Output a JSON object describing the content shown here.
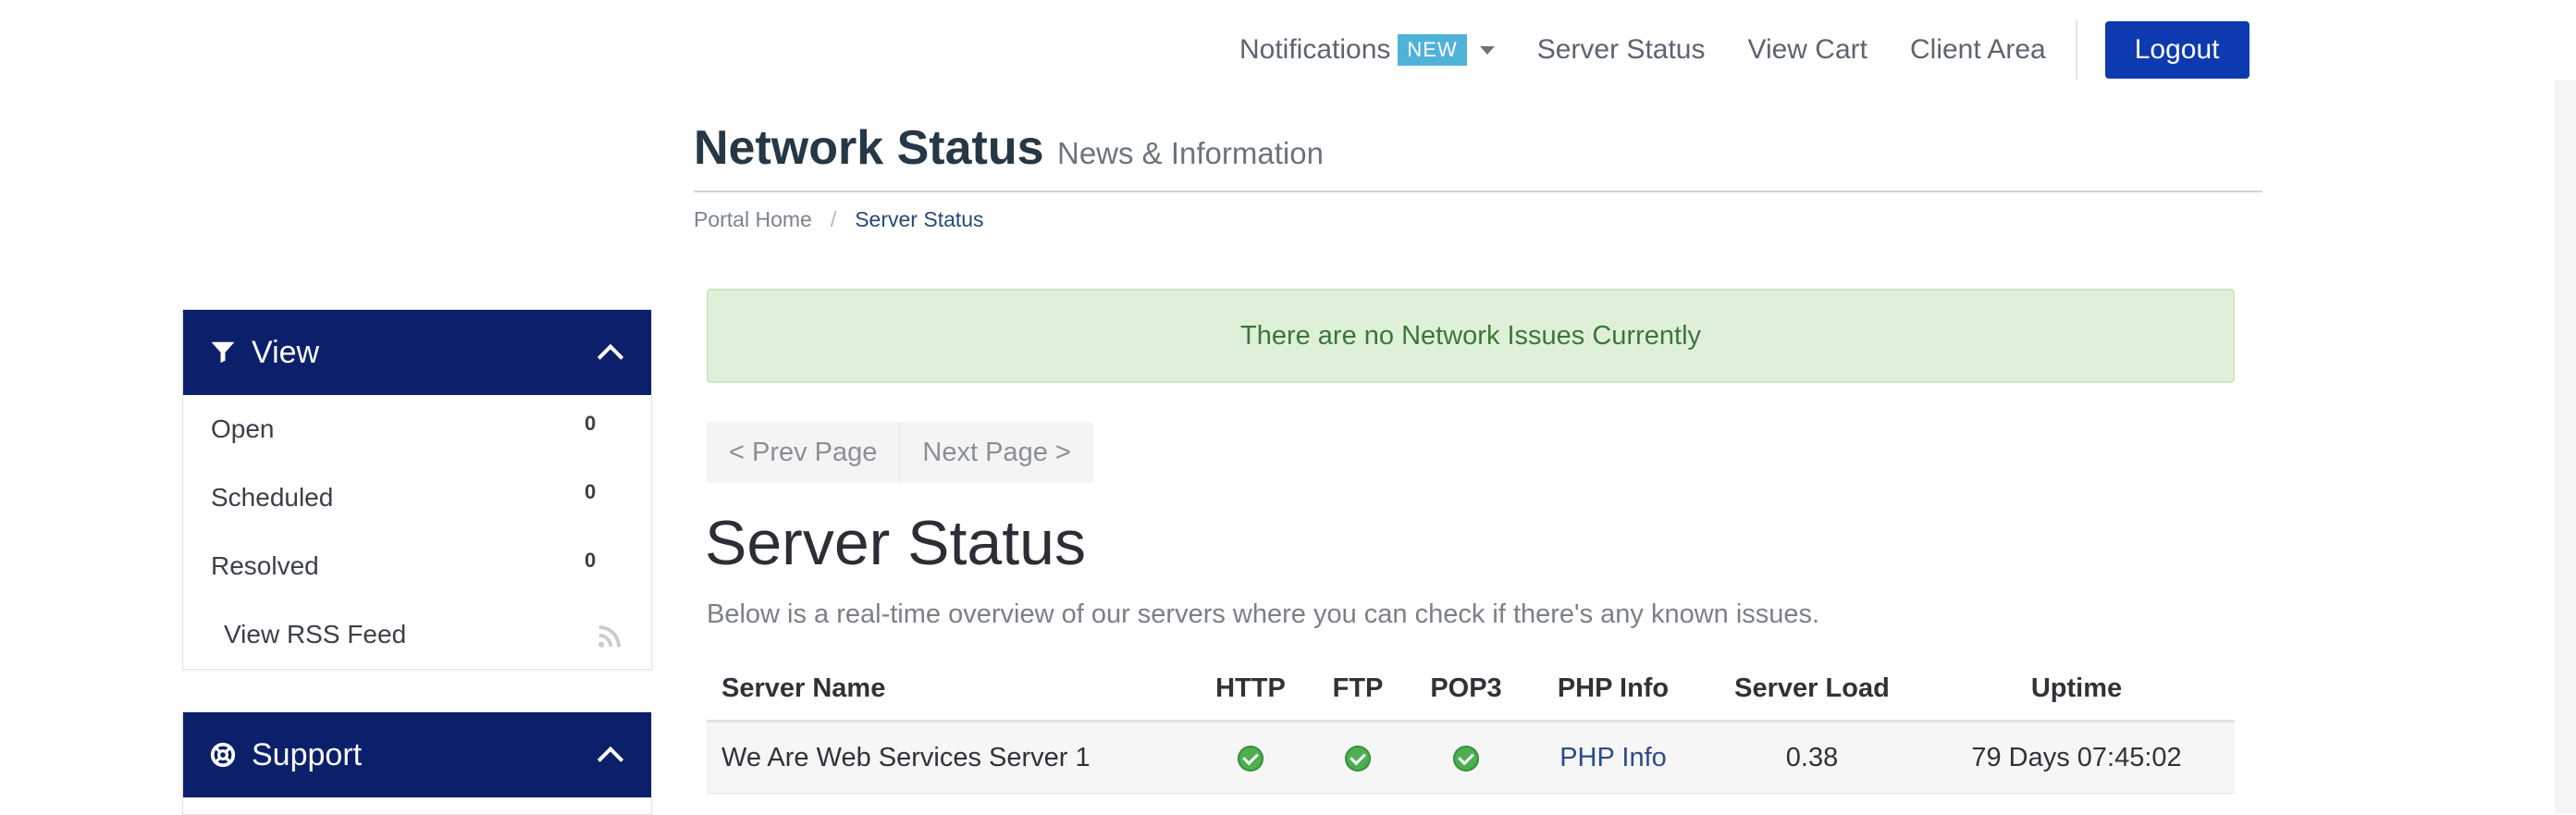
{
  "nav": {
    "notifications_label": "Notifications",
    "notifications_badge": "NEW",
    "server_status": "Server Status",
    "view_cart": "View Cart",
    "client_area": "Client Area",
    "logout": "Logout"
  },
  "header": {
    "title": "Network Status",
    "subtitle": "News & Information"
  },
  "breadcrumb": {
    "home": "Portal Home",
    "separator": "/",
    "current": "Server Status"
  },
  "sidebar": {
    "view": {
      "title": "View",
      "items": [
        {
          "label": "Open",
          "count": "0"
        },
        {
          "label": "Scheduled",
          "count": "0"
        },
        {
          "label": "Resolved",
          "count": "0"
        }
      ],
      "rss_label": "View RSS Feed"
    },
    "support": {
      "title": "Support"
    }
  },
  "alert": {
    "text": "There are no Network Issues Currently"
  },
  "pager": {
    "prev": "< Prev Page",
    "next": "Next Page >"
  },
  "server_status": {
    "title": "Server Status",
    "description": "Below is a real-time overview of our servers where you can check if there's any known issues.",
    "columns": [
      "Server Name",
      "HTTP",
      "FTP",
      "POP3",
      "PHP Info",
      "Server Load",
      "Uptime"
    ],
    "rows": [
      {
        "name": "We Are Web Services Server 1",
        "http": "ok",
        "ftp": "ok",
        "pop3": "ok",
        "php_info": "PHP Info",
        "load": "0.38",
        "uptime": "79 Days 07:45:02"
      }
    ]
  },
  "colors": {
    "brand_dark": "#0c1f6b",
    "logout_bg": "#0d3ab0",
    "badge": "#4fb3d9",
    "alert_bg": "#dff0d8",
    "ok_green": "#4caf50"
  },
  "icons": [
    "caret-down-icon",
    "filter-icon",
    "chevron-up-icon",
    "rss-icon",
    "support-icon",
    "check-circle-icon"
  ]
}
